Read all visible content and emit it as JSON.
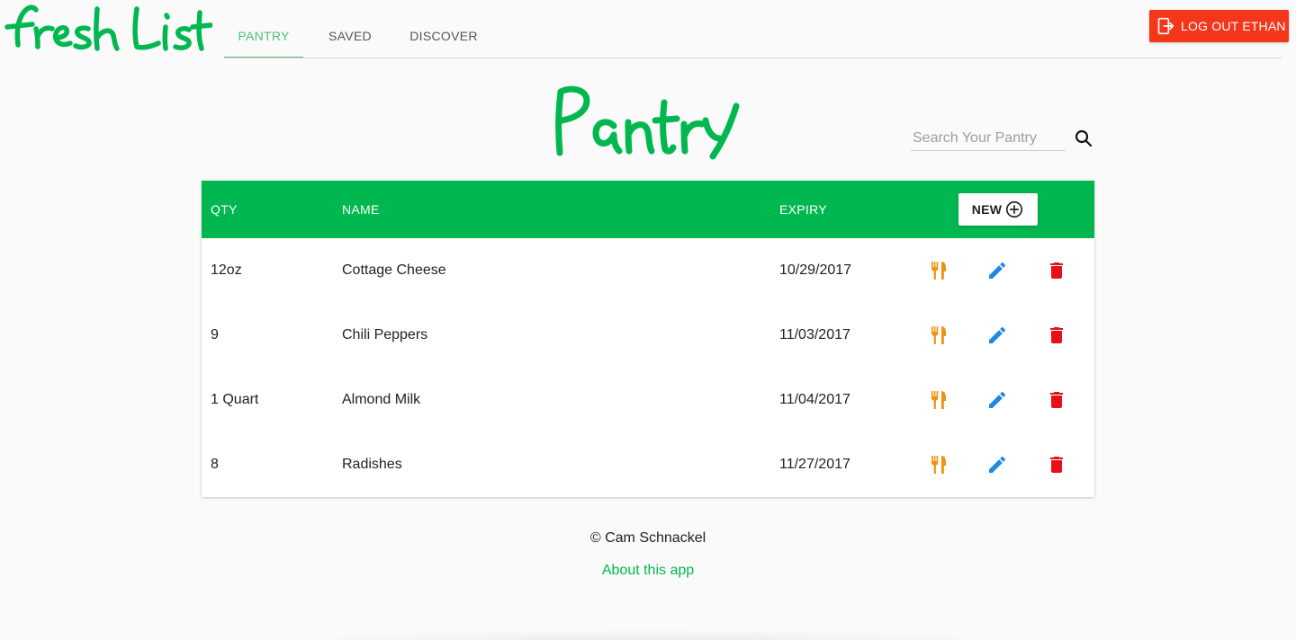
{
  "app": {
    "logo_text": "fresh List",
    "brand_color": "#00b84f",
    "accent_color": "#4ac46e"
  },
  "nav": {
    "tabs": [
      {
        "label": "PANTRY",
        "active": true
      },
      {
        "label": "SAVED",
        "active": false
      },
      {
        "label": "DISCOVER",
        "active": false
      }
    ]
  },
  "logout": {
    "label": "LOG OUT ETHAN",
    "icon": "logout-icon",
    "color": "#f4361b"
  },
  "page": {
    "title": "Pantry"
  },
  "search": {
    "placeholder": "Search Your Pantry",
    "value": "",
    "icon": "search-icon"
  },
  "table": {
    "headers": {
      "qty": "QTY",
      "name": "NAME",
      "expiry": "EXPIRY"
    },
    "new_label": "NEW",
    "new_icon": "add-circle-icon",
    "row_actions": [
      {
        "icon": "utensils-icon",
        "color": "#f29111"
      },
      {
        "icon": "pencil-icon",
        "color": "#1e88e5"
      },
      {
        "icon": "trash-icon",
        "color": "#e5101a"
      }
    ],
    "rows": [
      {
        "qty": "12oz",
        "name": "Cottage Cheese",
        "expiry": "10/29/2017"
      },
      {
        "qty": "9",
        "name": "Chili Peppers",
        "expiry": "11/03/2017"
      },
      {
        "qty": "1 Quart",
        "name": "Almond Milk",
        "expiry": "11/04/2017"
      },
      {
        "qty": "8",
        "name": "Radishes",
        "expiry": "11/27/2017"
      }
    ]
  },
  "footer": {
    "copyright": "© Cam Schnackel",
    "about_link": "About this app"
  }
}
